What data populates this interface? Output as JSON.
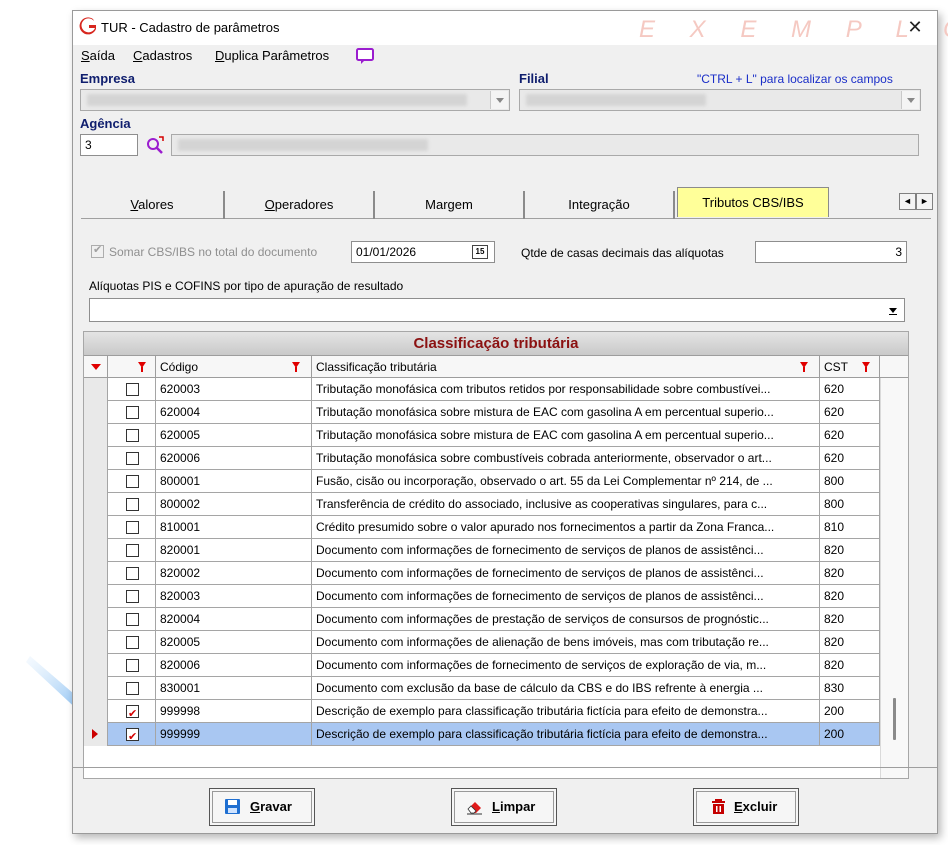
{
  "window": {
    "title": "TUR - Cadastro de parâmetros",
    "watermark": "E X E M P L O",
    "close_glyph": "✕"
  },
  "menu": {
    "items": [
      {
        "underline": "S",
        "rest": "aída"
      },
      {
        "underline": "C",
        "rest": "adastros"
      },
      {
        "underline": "D",
        "rest": "uplica Parâmetros"
      }
    ],
    "chat_icon": "chat-icon"
  },
  "header": {
    "empresa_label": "Empresa",
    "filial_label": "Filial",
    "hint": "\"CTRL + L\" para localizar os campos",
    "agencia_label": "Agência",
    "agencia_code": "3"
  },
  "tabs": [
    {
      "underline": "V",
      "rest": "alores"
    },
    {
      "underline": "O",
      "rest": "peradores"
    },
    {
      "underline": "",
      "rest": "Margem"
    },
    {
      "underline": "",
      "rest": "Integração"
    },
    {
      "underline": "",
      "rest": "Tributos CBS/IBS"
    }
  ],
  "tab_nav": {
    "left": "◄",
    "right": "►"
  },
  "tributos": {
    "somar_label": "Somar CBS/IBS no total do documento",
    "date_value": "01/01/2026",
    "calendar_day": "15",
    "decimais_label": "Qtde de casas decimais das alíquotas",
    "decimais_value": "3",
    "aliquotas_label": "Alíquotas PIS e COFINS por tipo de apuração de resultado",
    "aliquotas_value": ""
  },
  "grid": {
    "title": "Classificação tributária",
    "columns": {
      "codigo": "Código",
      "classificacao": "Classificação tributária",
      "cst": "CST"
    },
    "rows": [
      {
        "checked": false,
        "codigo": "620003",
        "desc": "Tributação monofásica com tributos retidos por responsabilidade sobre combustívei...",
        "cst": "620"
      },
      {
        "checked": false,
        "codigo": "620004",
        "desc": "Tributação monofásica sobre mistura de EAC com gasolina A em percentual superio...",
        "cst": "620"
      },
      {
        "checked": false,
        "codigo": "620005",
        "desc": "Tributação monofásica sobre mistura de EAC com gasolina A em percentual superio...",
        "cst": "620"
      },
      {
        "checked": false,
        "codigo": "620006",
        "desc": "Tributação monofásica sobre combustíveis cobrada anteriormente, observador o art...",
        "cst": "620"
      },
      {
        "checked": false,
        "codigo": "800001",
        "desc": "Fusão, cisão ou incorporação, observado o art. 55 da Lei Complementar nº 214, de ...",
        "cst": "800"
      },
      {
        "checked": false,
        "codigo": "800002",
        "desc": "Transferência de crédito do associado, inclusive as cooperativas singulares, para c...",
        "cst": "800"
      },
      {
        "checked": false,
        "codigo": "810001",
        "desc": "Crédito presumido sobre o valor apurado nos fornecimentos a partir da Zona Franca...",
        "cst": "810"
      },
      {
        "checked": false,
        "codigo": "820001",
        "desc": "Documento com informações de fornecimento de serviços de planos de assistênci...",
        "cst": "820"
      },
      {
        "checked": false,
        "codigo": "820002",
        "desc": "Documento com informações de fornecimento de serviços de planos de assistênci...",
        "cst": "820"
      },
      {
        "checked": false,
        "codigo": "820003",
        "desc": "Documento com informações de fornecimento de serviços de planos de assistênci...",
        "cst": "820"
      },
      {
        "checked": false,
        "codigo": "820004",
        "desc": "Documento com informações de prestação de serviços de consursos de prognóstic...",
        "cst": "820"
      },
      {
        "checked": false,
        "codigo": "820005",
        "desc": "Documento com informações de alienação de bens imóveis, mas com tributação re...",
        "cst": "820"
      },
      {
        "checked": false,
        "codigo": "820006",
        "desc": "Documento com informações de fornecimento de serviços de exploração de via, m...",
        "cst": "820"
      },
      {
        "checked": false,
        "codigo": "830001",
        "desc": "Documento com  exclusão da base de cálculo da CBS e do IBS refrente à energia ...",
        "cst": "830"
      },
      {
        "checked": true,
        "codigo": "999998",
        "desc": "Descrição de exemplo para classificação tributária fictícia para efeito de demonstra...",
        "cst": "200"
      },
      {
        "checked": true,
        "codigo": "999999",
        "desc": "Descrição de exemplo para classificação tributária fictícia para efeito de demonstra...",
        "cst": "200",
        "selected": true
      }
    ]
  },
  "buttons": {
    "gravar": {
      "underline": "G",
      "rest": "ravar"
    },
    "limpar": {
      "underline": "L",
      "rest": "impar"
    },
    "excluir": {
      "underline": "E",
      "rest": "xcluir"
    }
  },
  "colors": {
    "accent_red": "#cc0000",
    "selected_row": "#a9c7f2",
    "active_tab": "#ffff99",
    "grid_title": "#8b1111",
    "label_blue": "#0f1e6e"
  }
}
